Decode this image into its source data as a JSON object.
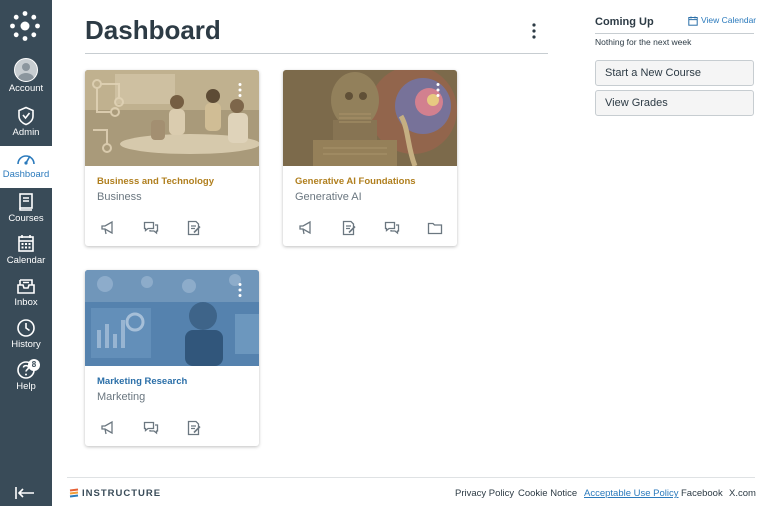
{
  "nav": {
    "items": [
      {
        "id": "account",
        "label": "Account",
        "icon": "user-avatar-icon"
      },
      {
        "id": "admin",
        "label": "Admin",
        "icon": "shield-icon"
      },
      {
        "id": "dashboard",
        "label": "Dashboard",
        "icon": "speedometer-icon"
      },
      {
        "id": "courses",
        "label": "Courses",
        "icon": "book-icon"
      },
      {
        "id": "calendar",
        "label": "Calendar",
        "icon": "calendar-icon"
      },
      {
        "id": "inbox",
        "label": "Inbox",
        "icon": "inbox-icon"
      },
      {
        "id": "history",
        "label": "History",
        "icon": "clock-icon"
      },
      {
        "id": "help",
        "label": "Help",
        "icon": "question-icon",
        "badge": "8"
      }
    ]
  },
  "header": {
    "title": "Dashboard"
  },
  "cards": [
    {
      "name": "Business and Technology",
      "subtitle": "Business",
      "name_color": "#b07f1e",
      "image": "meeting-room-photo"
    },
    {
      "name": "Generative AI Foundations",
      "subtitle": "Generative AI",
      "name_color": "#b07f1e",
      "image": "robot-photo"
    },
    {
      "name": "Marketing Research",
      "subtitle": "Marketing",
      "name_color": "#2b6fa8",
      "image": "analytics-photo"
    }
  ],
  "sidebar": {
    "coming_up": "Coming Up",
    "view_calendar": "View Calendar",
    "nothing": "Nothing for the next week",
    "start_course": "Start a New Course",
    "view_grades": "View Grades"
  },
  "footer": {
    "brand": "INSTRUCTURE",
    "links": [
      "Privacy Policy",
      "Cookie Notice",
      "Acceptable Use Policy",
      "Facebook",
      "X.com"
    ]
  },
  "colors": {
    "nav_bg": "#394b58",
    "accent": "#2b7abc",
    "gold": "#b07f1e"
  }
}
